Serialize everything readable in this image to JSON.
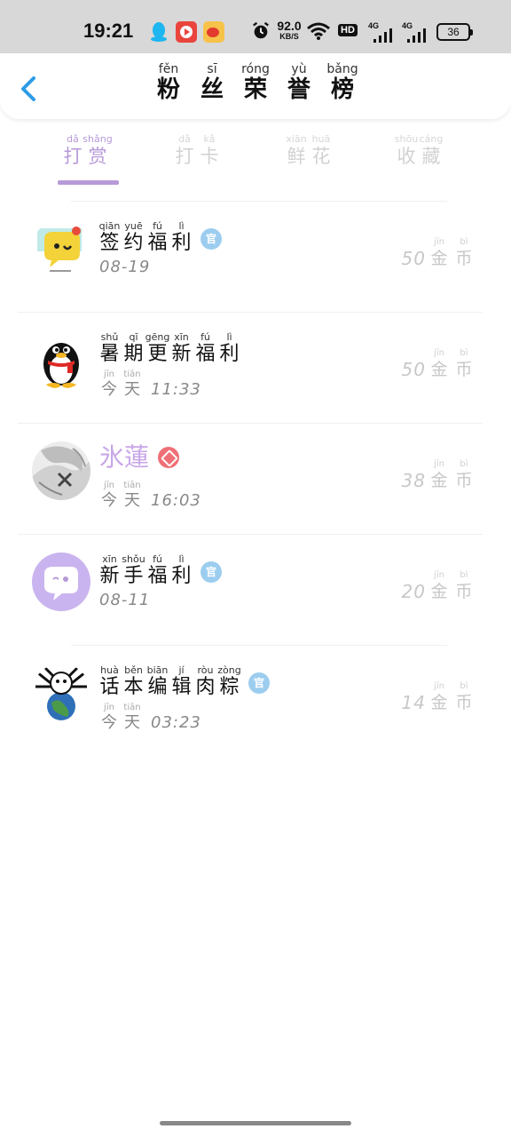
{
  "status_bar": {
    "time": "19:21",
    "net_speed": "92.0",
    "net_unit": "KB/S",
    "hd": "HD",
    "signal_1": "4G",
    "signal_2": "4G",
    "battery": "36",
    "icons": [
      "qq-icon",
      "video-app-icon",
      "weibo-icon",
      "alarm-icon",
      "wifi-icon"
    ]
  },
  "header": {
    "back_icon": "chevron-left-icon",
    "accent": "#2d9be6",
    "title": [
      {
        "py": "fěn",
        "hz": "粉"
      },
      {
        "py": "sī",
        "hz": "丝"
      },
      {
        "py": "róng",
        "hz": "荣"
      },
      {
        "py": "yù",
        "hz": "誉"
      },
      {
        "py": "bǎng",
        "hz": "榜"
      }
    ]
  },
  "tabs": [
    {
      "chars": [
        {
          "py": "dǎ",
          "hz": "打"
        },
        {
          "py": "shǎng",
          "hz": "赏"
        }
      ],
      "active": true
    },
    {
      "chars": [
        {
          "py": "dǎ",
          "hz": "打"
        },
        {
          "py": "kǎ",
          "hz": "卡"
        }
      ],
      "active": false
    },
    {
      "chars": [
        {
          "py": "xiān",
          "hz": "鲜"
        },
        {
          "py": "huā",
          "hz": "花"
        }
      ],
      "active": false
    },
    {
      "chars": [
        {
          "py": "shōu",
          "hz": "收"
        },
        {
          "py": "cáng",
          "hz": "藏"
        }
      ],
      "active": false
    }
  ],
  "colors": {
    "active_tab": "#b79ad8",
    "vip_name": "#c8a6e8",
    "official_badge": "#9ccdef",
    "gem_badge": "#ef6f76"
  },
  "list": [
    {
      "name_chars": [
        {
          "py": "qiān",
          "hz": "签"
        },
        {
          "py": "yuē",
          "hz": "约"
        },
        {
          "py": "fú",
          "hz": "福"
        },
        {
          "py": "lì",
          "hz": "利"
        }
      ],
      "badge": "官",
      "time": "08-19",
      "coins": "50",
      "avatar": "chat-bubble-avatar"
    },
    {
      "name_chars": [
        {
          "py": "shǔ",
          "hz": "暑"
        },
        {
          "py": "qī",
          "hz": "期"
        },
        {
          "py": "gēng",
          "hz": "更"
        },
        {
          "py": "xīn",
          "hz": "新"
        },
        {
          "py": "fú",
          "hz": "福"
        },
        {
          "py": "lì",
          "hz": "利"
        }
      ],
      "badge": "",
      "time_day": [
        {
          "py": "jīn",
          "hz": "今"
        },
        {
          "py": "tiān",
          "hz": "天"
        }
      ],
      "time": "11:33",
      "coins": "50",
      "avatar": "penguin-avatar"
    },
    {
      "name_plain": "氷蓮",
      "badge": "gem",
      "time_day": [
        {
          "py": "jīn",
          "hz": "今"
        },
        {
          "py": "tiān",
          "hz": "天"
        }
      ],
      "time": "16:03",
      "coins": "38",
      "avatar": "anime-photo-avatar"
    },
    {
      "name_chars": [
        {
          "py": "xīn",
          "hz": "新"
        },
        {
          "py": "shǒu",
          "hz": "手"
        },
        {
          "py": "fú",
          "hz": "福"
        },
        {
          "py": "lì",
          "hz": "利"
        }
      ],
      "badge": "官",
      "time": "08-11",
      "coins": "20",
      "avatar": "purple-chat-avatar"
    },
    {
      "name_chars": [
        {
          "py": "huà",
          "hz": "话"
        },
        {
          "py": "běn",
          "hz": "本"
        },
        {
          "py": "biān",
          "hz": "编"
        },
        {
          "py": "jí",
          "hz": "辑"
        },
        {
          "py": "ròu",
          "hz": "肉"
        },
        {
          "py": "zòng",
          "hz": "粽"
        }
      ],
      "badge": "官",
      "time_day": [
        {
          "py": "jīn",
          "hz": "今"
        },
        {
          "py": "tiān",
          "hz": "天"
        }
      ],
      "time": "03:23",
      "coins": "14",
      "avatar": "spider-earth-avatar"
    }
  ],
  "coin_unit": [
    {
      "py": "jīn",
      "hz": "金"
    },
    {
      "py": "bì",
      "hz": "币"
    }
  ]
}
